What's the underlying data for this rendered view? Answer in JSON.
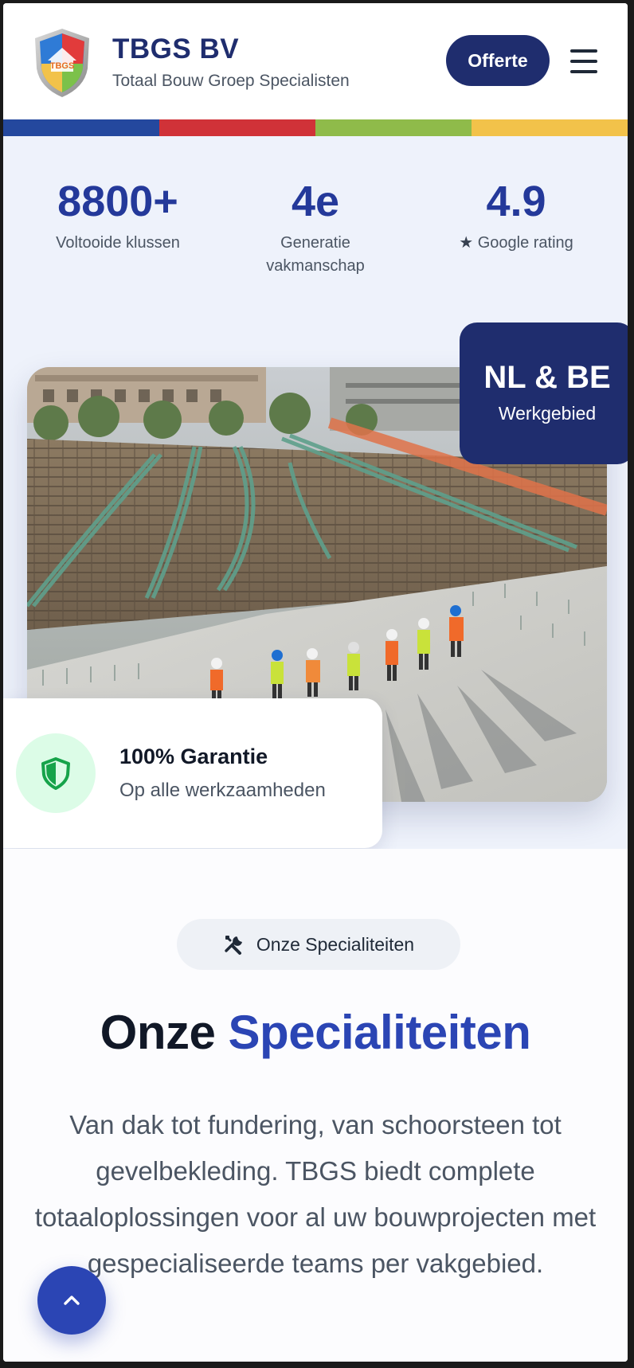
{
  "header": {
    "brand_name": "TBGS BV",
    "brand_subtitle": "Totaal Bouw Groep Specialisten",
    "logo_text": "TBGS",
    "cta_label": "Offerte",
    "menu_icon": "hamburger-menu-icon"
  },
  "brand_stripe": [
    "#24489e",
    "#d03238",
    "#8fbb4a",
    "#f2c24a"
  ],
  "stats": [
    {
      "value": "8800+",
      "label": "Voltooide klussen"
    },
    {
      "value": "4e",
      "label": "Generatie vakmanschap"
    },
    {
      "value": "4.9",
      "label": "Google rating",
      "icon": "star-icon"
    }
  ],
  "region_badge": {
    "title": "NL & BE",
    "subtitle": "Werkgebied"
  },
  "guarantee": {
    "title": "100% Garantie",
    "subtitle": "Op alle werkzaamheden",
    "icon": "shield-icon"
  },
  "specialties": {
    "pill_label": "Onze Specialiteiten",
    "pill_icon": "tools-icon",
    "title_prefix": "Onze",
    "title_accent": "Specialiteiten",
    "description": "Van dak tot fundering, van schoorsteen tot gevelbekleding. TBGS biedt complete totaaloplossingen voor al uw bouwprojecten met gespecialiseerde teams per vakgebied."
  },
  "scroll_top_icon": "chevron-up-icon",
  "colors": {
    "primary": "#1f2d6e",
    "accent": "#2b45b4",
    "stat_blue": "#24399a",
    "guarantee_green": "#16a34a"
  }
}
